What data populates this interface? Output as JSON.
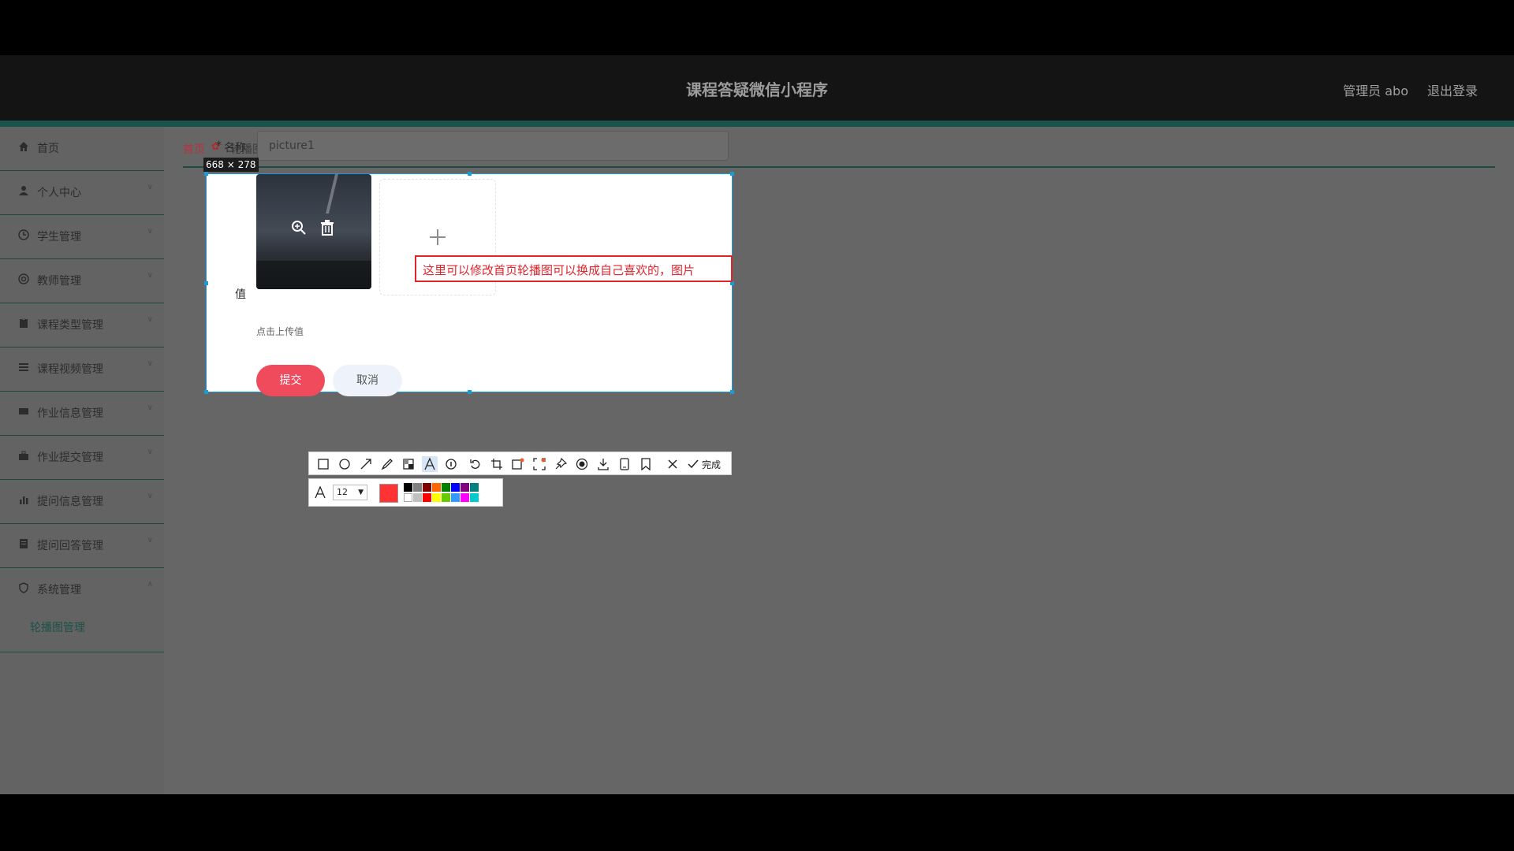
{
  "header": {
    "title": "课程答疑微信小程序",
    "user": "管理员 abo",
    "logout": "退出登录"
  },
  "sidebar": {
    "items": [
      {
        "label": "首页",
        "icon": "home-icon"
      },
      {
        "label": "个人中心",
        "icon": "user-icon"
      },
      {
        "label": "学生管理",
        "icon": "clock-icon"
      },
      {
        "label": "教师管理",
        "icon": "target-icon"
      },
      {
        "label": "课程类型管理",
        "icon": "clipboard-icon"
      },
      {
        "label": "课程视频管理",
        "icon": "list-icon"
      },
      {
        "label": "作业信息管理",
        "icon": "card-icon"
      },
      {
        "label": "作业提交管理",
        "icon": "briefcase-icon"
      },
      {
        "label": "提问信息管理",
        "icon": "bar-chart-icon"
      },
      {
        "label": "提问回答管理",
        "icon": "document-icon"
      },
      {
        "label": "系统管理",
        "icon": "shield-icon"
      }
    ],
    "sub_item": "轮播图管理"
  },
  "breadcrumb": {
    "home": "首页",
    "current": "轮播图管理"
  },
  "form": {
    "name_label": "名称",
    "required_mark": "*",
    "name_value": "picture1",
    "value_label": "值",
    "upload_hint": "点击上传值",
    "submit": "提交",
    "cancel": "取消"
  },
  "screenshot_tool": {
    "dimensions": "668 × 278",
    "annotation_text": "这里可以修改首页轮播图可以换成自己喜欢的，图片",
    "done": "完成",
    "font_size": "12",
    "current_color": "#ff3333",
    "palette_top": [
      "#000000",
      "#808080",
      "#800000",
      "#ff6600",
      "#008000",
      "#0000ff",
      "#800080",
      "#008080"
    ],
    "palette_bottom": [
      "#ffffff",
      "#c0c0c0",
      "#ff0000",
      "#ffff00",
      "#66cc00",
      "#3399ff",
      "#ff00ff",
      "#00cccc"
    ]
  },
  "colors": {
    "accent_teal": "#17544c",
    "submit_red": "#ef4b5c",
    "annotation_red": "#e0242c",
    "selection_blue": "#1a9bd6"
  }
}
